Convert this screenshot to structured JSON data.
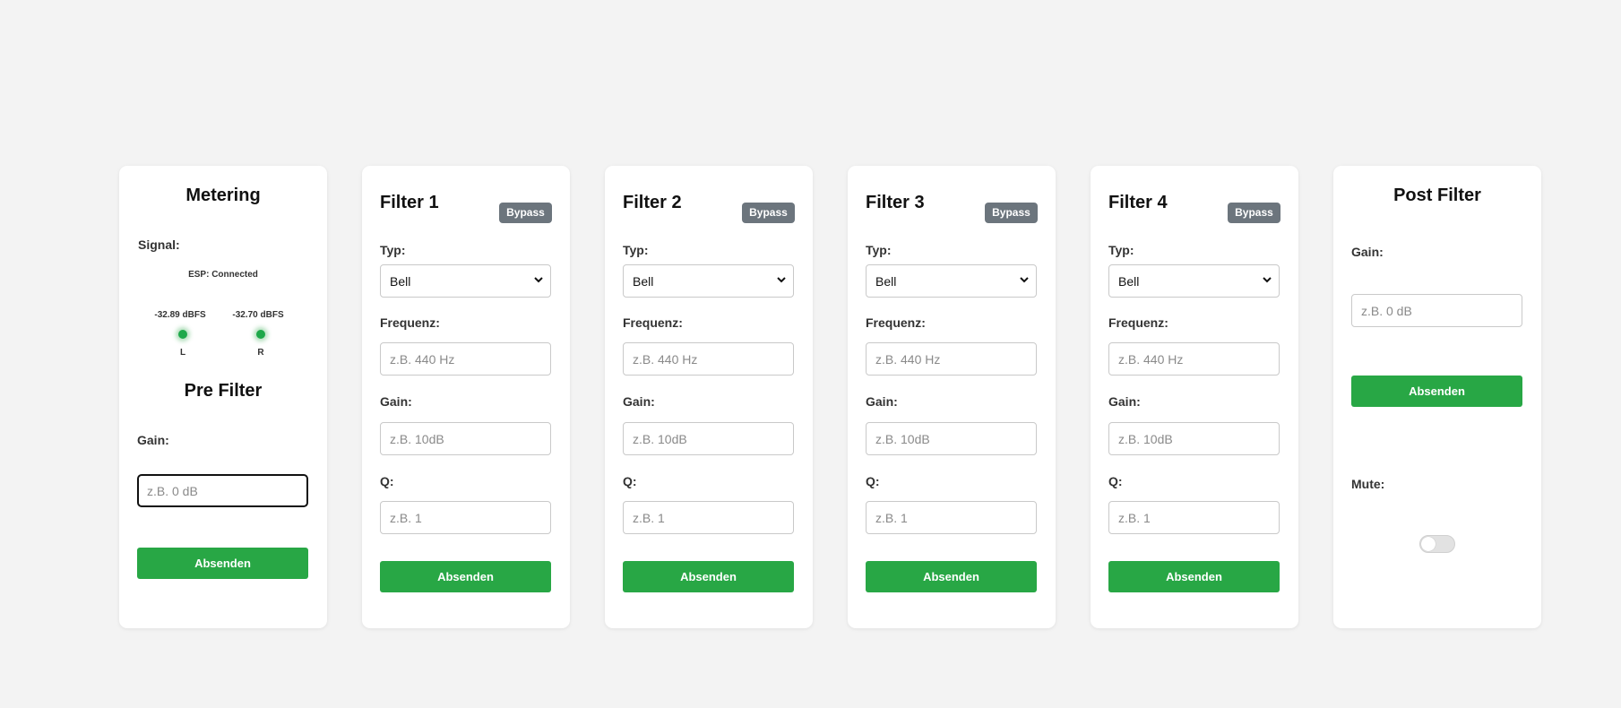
{
  "metering": {
    "title": "Metering",
    "signal_label": "Signal:",
    "esp_status": "ESP: Connected",
    "left_level": "-32.89 dBFS",
    "right_level": "-32.70 dBFS",
    "left_channel": "L",
    "right_channel": "R",
    "led_color": "#28a745"
  },
  "pre_filter": {
    "title": "Pre Filter",
    "gain_label": "Gain:",
    "gain_placeholder": "z.B. 0 dB",
    "submit_label": "Absenden"
  },
  "filters": [
    {
      "title": "Filter 1",
      "bypass_label": "Bypass",
      "type_label": "Typ:",
      "type_value": "Bell",
      "freq_label": "Frequenz:",
      "freq_placeholder": "z.B. 440 Hz",
      "gain_label": "Gain:",
      "gain_placeholder": "z.B. 10dB",
      "q_label": "Q:",
      "q_placeholder": "z.B. 1",
      "submit_label": "Absenden"
    },
    {
      "title": "Filter 2",
      "bypass_label": "Bypass",
      "type_label": "Typ:",
      "type_value": "Bell",
      "freq_label": "Frequenz:",
      "freq_placeholder": "z.B. 440 Hz",
      "gain_label": "Gain:",
      "gain_placeholder": "z.B. 10dB",
      "q_label": "Q:",
      "q_placeholder": "z.B. 1",
      "submit_label": "Absenden"
    },
    {
      "title": "Filter 3",
      "bypass_label": "Bypass",
      "type_label": "Typ:",
      "type_value": "Bell",
      "freq_label": "Frequenz:",
      "freq_placeholder": "z.B. 440 Hz",
      "gain_label": "Gain:",
      "gain_placeholder": "z.B. 10dB",
      "q_label": "Q:",
      "q_placeholder": "z.B. 1",
      "submit_label": "Absenden"
    },
    {
      "title": "Filter 4",
      "bypass_label": "Bypass",
      "type_label": "Typ:",
      "type_value": "Bell",
      "freq_label": "Frequenz:",
      "freq_placeholder": "z.B. 440 Hz",
      "gain_label": "Gain:",
      "gain_placeholder": "z.B. 10dB",
      "q_label": "Q:",
      "q_placeholder": "z.B. 1",
      "submit_label": "Absenden"
    }
  ],
  "post_filter": {
    "title": "Post Filter",
    "gain_label": "Gain:",
    "gain_placeholder": "z.B. 0 dB",
    "submit_label": "Absenden",
    "mute_label": "Mute:",
    "mute_on": false
  },
  "colors": {
    "page_bg": "#f3f3f3",
    "submit_green": "#28a745",
    "bypass_gray": "#6c757d"
  }
}
